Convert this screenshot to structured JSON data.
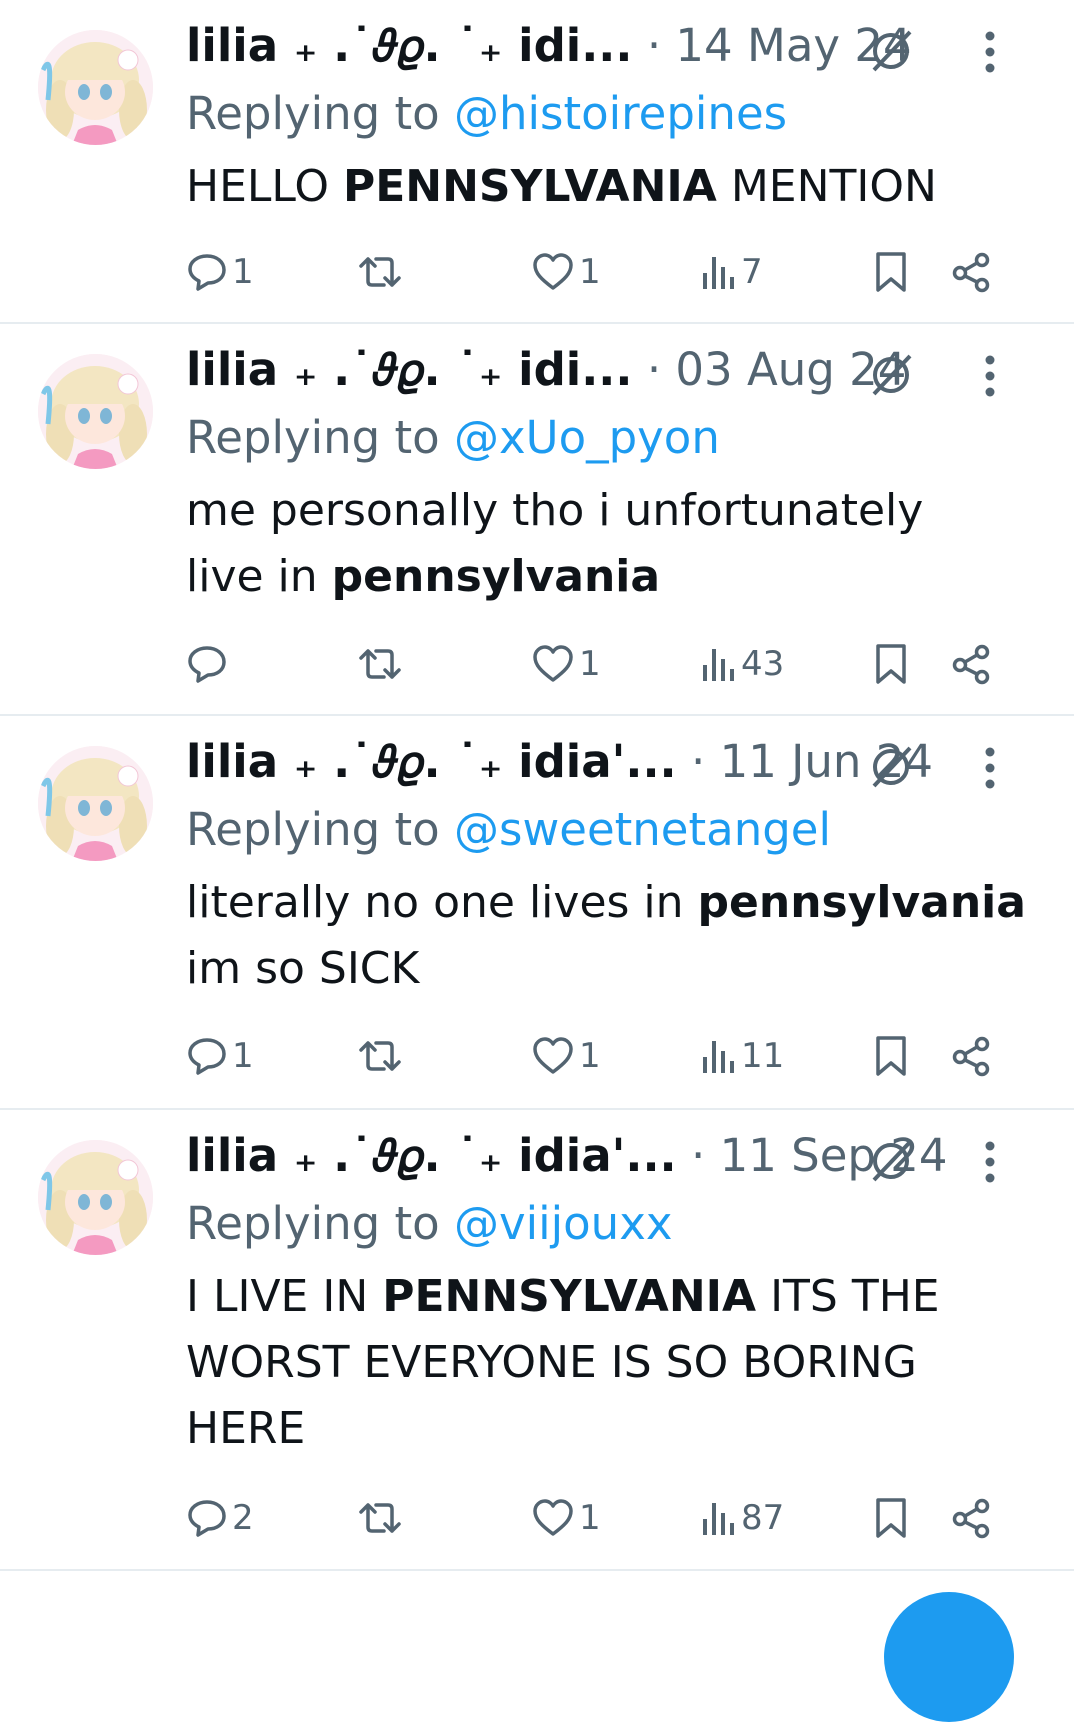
{
  "tweets": [
    {
      "author_name": "lilia ₊ .˙𝜗𝜚. ˙₊ idi...",
      "date": "14 May 24",
      "reply_label": "Replying to",
      "reply_handle": "@histoirepines",
      "text_html": "HELLO <b>PENNSYLVANIA</b> MENTION",
      "replies": "1",
      "retweets": "",
      "likes": "1",
      "views": "7"
    },
    {
      "author_name": "lilia ₊ .˙𝜗𝜚. ˙₊ idi...",
      "date": "03 Aug 24",
      "reply_label": "Replying to",
      "reply_handle": "@xUo_pyon",
      "text_html": "me personally tho i unfortunately<br>live in <b>pennsylvania</b>",
      "replies": "",
      "retweets": "",
      "likes": "1",
      "views": "43"
    },
    {
      "author_name": "lilia ₊ .˙𝜗𝜚. ˙₊ idia'...",
      "date": "11 Jun 24",
      "reply_label": "Replying to",
      "reply_handle": "@sweetnetangel",
      "text_html": "literally no one lives in <b>pennsylvania</b><br>im so SICK",
      "replies": "1",
      "retweets": "",
      "likes": "1",
      "views": "11"
    },
    {
      "author_name": "lilia ₊ .˙𝜗𝜚. ˙₊ idia'...",
      "date": "11 Sep 24",
      "reply_label": "Replying to",
      "reply_handle": "@viijouxx",
      "text_html": "I LIVE IN <b>PENNSYLVANIA</b> ITS THE<br>WORST EVERYONE IS SO BORING<br>HERE",
      "replies": "2",
      "retweets": "",
      "likes": "1",
      "views": "87"
    }
  ],
  "colors": {
    "text": "#0f1419",
    "secondary": "#536471",
    "link": "#1d9bf0",
    "divider": "#e6ecf0"
  },
  "icons": [
    "avatar",
    "verified-off-icon",
    "more-icon",
    "reply-icon",
    "retweet-icon",
    "like-icon",
    "views-icon",
    "bookmark-icon",
    "share-icon"
  ]
}
